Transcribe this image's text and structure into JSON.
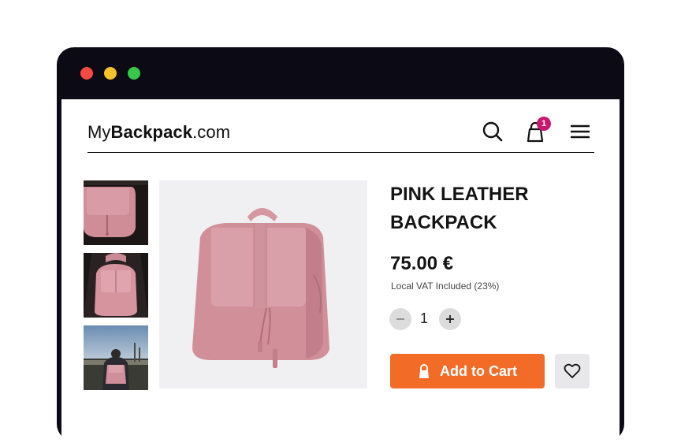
{
  "brand": {
    "prefix": "My",
    "bold": "Backpack",
    "suffix": ".com"
  },
  "cart": {
    "count": "1"
  },
  "product": {
    "title": "PINK LEATHER BACKPACK",
    "price": "75.00 €",
    "vat_note": "Local VAT Included (23%)",
    "quantity": "1",
    "add_to_cart_label": "Add to Cart"
  },
  "icons": [
    "search-icon",
    "shopping-bag-icon",
    "hamburger-menu-icon",
    "minus-icon",
    "plus-icon",
    "lock-icon",
    "heart-icon"
  ],
  "colors": {
    "accent": "#f26c27",
    "badge": "#c9186f",
    "window_frame": "#0c0a14",
    "product": "#d89aa2"
  }
}
